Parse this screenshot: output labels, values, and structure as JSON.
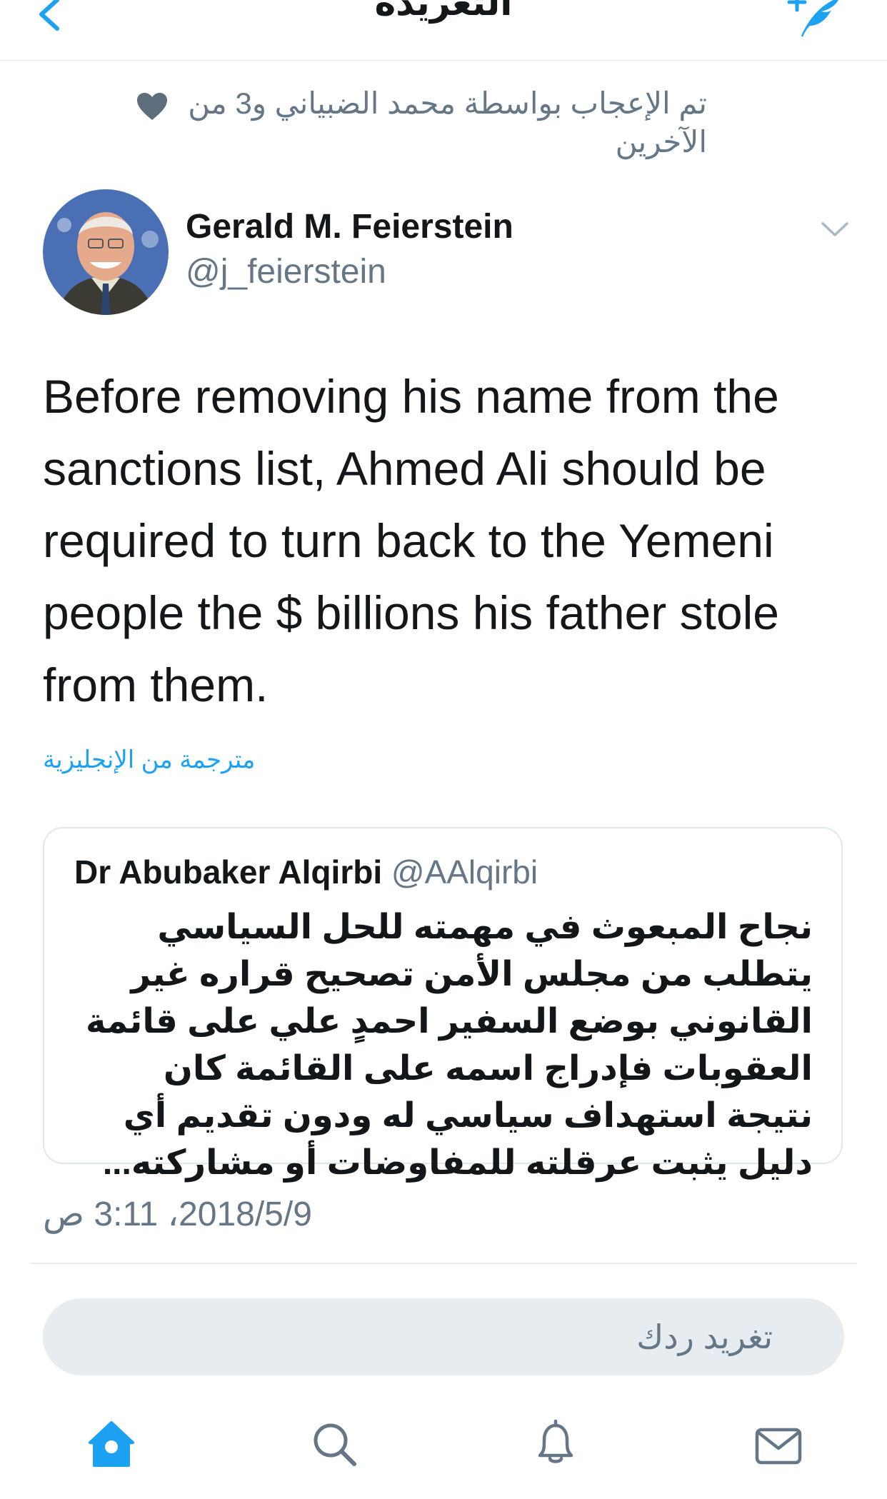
{
  "header": {
    "title": "التغريدة"
  },
  "liked_by": {
    "text": "تم الإعجاب بواسطة محمد الضبياني و3 من الآخرين"
  },
  "author": {
    "name": "Gerald M. Feierstein",
    "handle": "@j_feierstein"
  },
  "tweet": {
    "text": "Before removing his name from the sanctions list, Ahmed Ali should be required to turn back to the Yemeni people the $ billions his father stole from them.",
    "translated_label": "مترجمة من الإنجليزية",
    "timestamp": "2018/5/9، 3:11 ص"
  },
  "quoted_tweet": {
    "name": "Dr Abubaker Alqirbi",
    "handle": "@AAlqirbi",
    "text": "نجاح المبعوث في مهمته للحل السياسي يتطلب من مجلس الأمن تصحيح قراره غير القانوني بوضع السفير احمدٍ علي على قائمة العقوبات فإدراج اسمه على القائمة كان نتيجة استهداف سياسي له ودون تقديم أي دليل يثبت عرقلته للمفاوضات أو مشاركته..."
  },
  "reply": {
    "placeholder": "تغريد ردك"
  },
  "icons": {
    "back": "chevron-left-icon",
    "compose": "feather-plus-icon",
    "heart": "heart-icon",
    "more": "chevron-down-icon",
    "home": "home-icon",
    "search": "search-icon",
    "notifications": "bell-icon",
    "messages": "envelope-icon"
  },
  "colors": {
    "accent": "#1da1f2",
    "secondary_text": "#657786",
    "heart": "#5d6d7c",
    "divider": "#e1e8ed",
    "reply_bg": "#e6ecf0"
  }
}
